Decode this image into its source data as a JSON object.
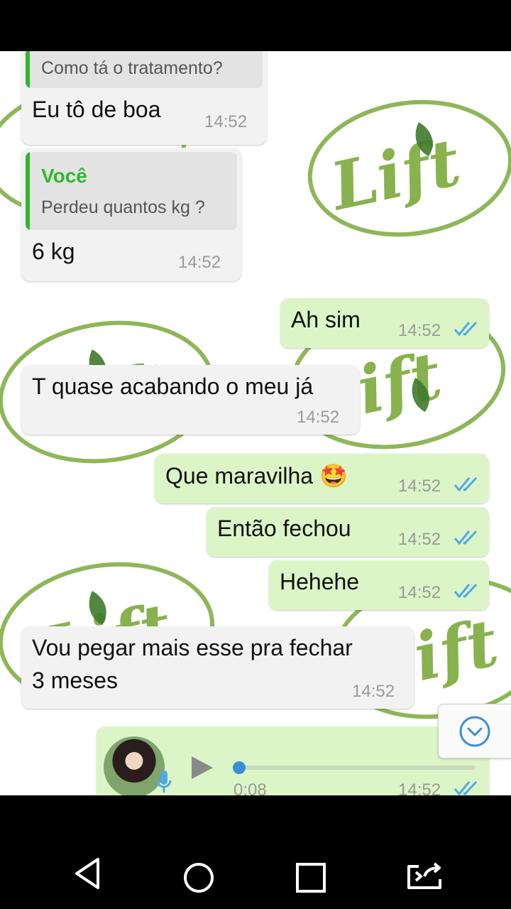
{
  "messages": [
    {
      "dir": "in",
      "quote_text": "Como tá o tratamento?",
      "text": "Eu tô de boa",
      "time": "14:52"
    },
    {
      "dir": "in",
      "quote_author": "Você",
      "quote_text": "Perdeu quantos kg ?",
      "text": "6 kg",
      "time": "14:52"
    },
    {
      "dir": "out",
      "text": "Ah sim",
      "time": "14:52",
      "status": "read"
    },
    {
      "dir": "in",
      "text": "T quase acabando o meu já",
      "time": "14:52"
    },
    {
      "dir": "out",
      "text": "Que maravilha 🤩",
      "time": "14:52",
      "status": "read"
    },
    {
      "dir": "out",
      "text": "Então fechou",
      "time": "14:52",
      "status": "read"
    },
    {
      "dir": "out",
      "text": "Hehehe",
      "time": "14:52",
      "status": "read"
    },
    {
      "dir": "in",
      "text_lines": [
        "Vou pegar mais esse pra fechar",
        "3 meses"
      ],
      "time": "14:52"
    },
    {
      "dir": "out",
      "type": "voice",
      "duration": "0:08",
      "time": "14:52",
      "status": "read",
      "progress": 0.0
    }
  ],
  "wallpaper": {
    "logo_text": "Lift",
    "color": "#7aaa3a"
  },
  "colors": {
    "incoming": "#f2f2f2",
    "outgoing": "#dcf5c6",
    "quote_accent": "#2db82d",
    "read_ticks": "#4fa9e6"
  },
  "icons": {
    "scroll_down": "chevron-down-icon",
    "nav": [
      "back-icon",
      "home-icon",
      "recents-icon",
      "screen-cast-icon"
    ]
  }
}
